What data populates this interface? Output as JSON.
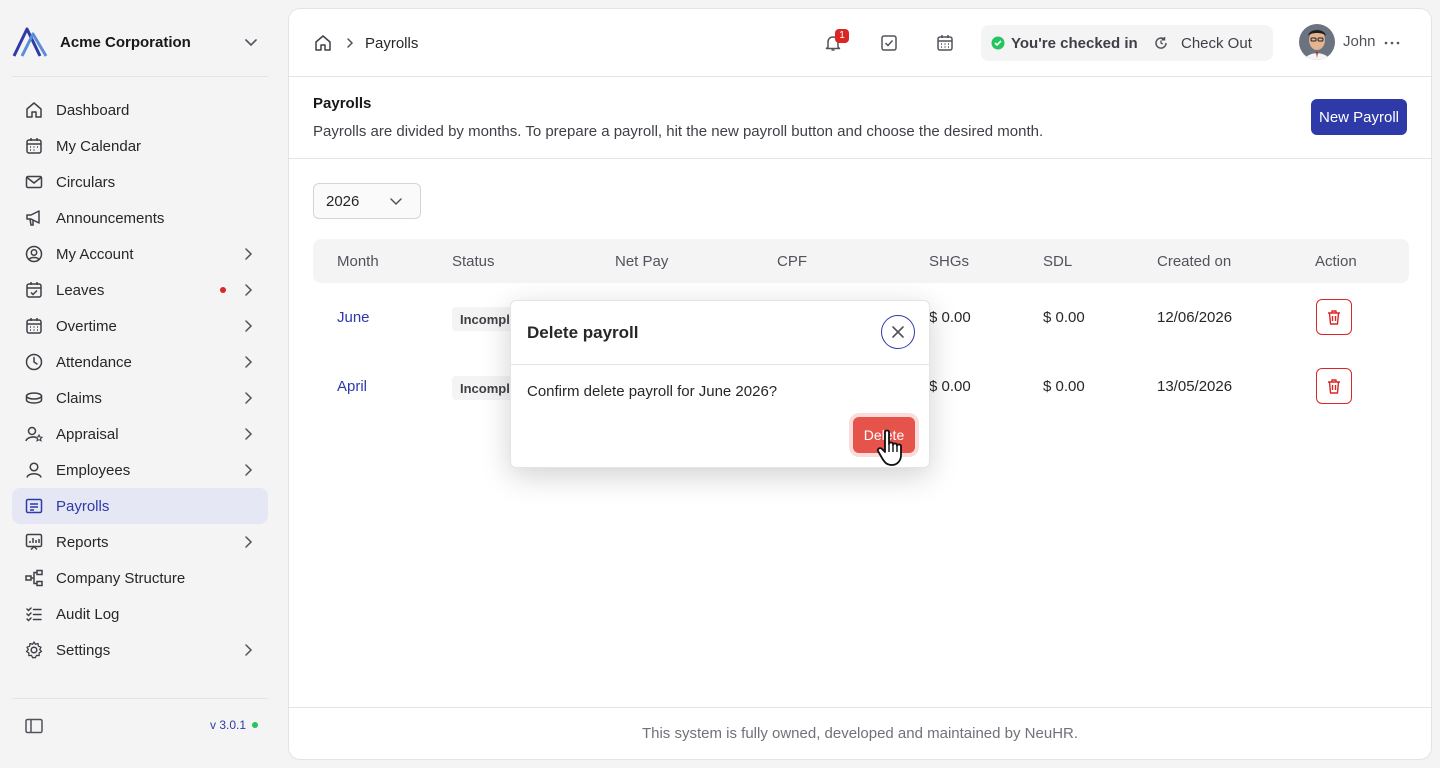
{
  "org": {
    "name": "Acme Corporation"
  },
  "sidebar": {
    "items": [
      {
        "label": "Dashboard",
        "icon": "home-icon",
        "arrow": false
      },
      {
        "label": "My Calendar",
        "icon": "calendar-icon",
        "arrow": false
      },
      {
        "label": "Circulars",
        "icon": "mail-icon",
        "arrow": false
      },
      {
        "label": "Announcements",
        "icon": "megaphone-icon",
        "arrow": false
      },
      {
        "label": "My Account",
        "icon": "user-circle-icon",
        "arrow": true
      },
      {
        "label": "Leaves",
        "icon": "calendar-check-icon",
        "arrow": true,
        "dot": true
      },
      {
        "label": "Overtime",
        "icon": "calendar-clock-icon",
        "arrow": true
      },
      {
        "label": "Attendance",
        "icon": "clock-icon",
        "arrow": true
      },
      {
        "label": "Claims",
        "icon": "coins-icon",
        "arrow": true
      },
      {
        "label": "Appraisal",
        "icon": "user-star-icon",
        "arrow": true
      },
      {
        "label": "Employees",
        "icon": "user-icon",
        "arrow": true
      },
      {
        "label": "Payrolls",
        "icon": "receipt-icon",
        "arrow": false,
        "active": true
      },
      {
        "label": "Reports",
        "icon": "chart-icon",
        "arrow": true
      },
      {
        "label": "Company Structure",
        "icon": "hierarchy-icon",
        "arrow": false
      },
      {
        "label": "Audit Log",
        "icon": "checklist-icon",
        "arrow": false
      },
      {
        "label": "Settings",
        "icon": "gear-icon",
        "arrow": true
      }
    ],
    "version": "v 3.0.1"
  },
  "topbar": {
    "breadcrumb_current": "Payrolls",
    "notification_count": "1",
    "checkin_status": "You're checked in",
    "checkout_label": "Check Out",
    "user_name": "John"
  },
  "page": {
    "title": "Payrolls",
    "description": "Payrolls are divided by months. To prepare a payroll, hit the new payroll button and choose the desired month.",
    "new_button": "New Payroll",
    "year": "2026"
  },
  "table": {
    "headers": [
      "Month",
      "Status",
      "Net Pay",
      "CPF",
      "SHGs",
      "SDL",
      "Created on",
      "Action"
    ],
    "rows": [
      {
        "month": "June",
        "status": "Incomple",
        "shgs": "$ 0.00",
        "sdl": "$ 0.00",
        "created": "12/06/2026"
      },
      {
        "month": "April",
        "status": "Incomple",
        "shgs": "$ 0.00",
        "sdl": "$ 0.00",
        "created": "13/05/2026"
      }
    ]
  },
  "modal": {
    "title": "Delete payroll",
    "body": "Confirm delete payroll for June 2026?",
    "delete_label": "Delete"
  },
  "footer": {
    "text": "This system is fully owned, developed and maintained by NeuHR."
  },
  "colors": {
    "brand": "#2e3aa8",
    "danger": "#dc2626",
    "success": "#22c55e"
  }
}
